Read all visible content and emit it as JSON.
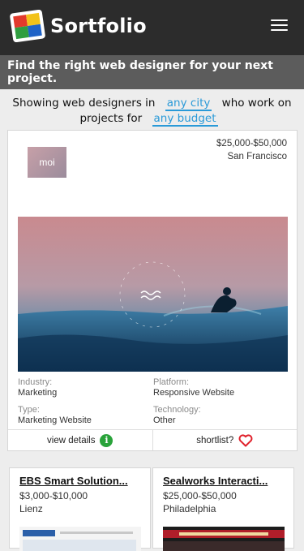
{
  "header": {
    "brand": "Sortfolio",
    "logo_icon": "sortfolio-logo-icon",
    "menu_icon": "hamburger-menu-icon"
  },
  "tagline": "Find the right web designer for your next project.",
  "filter": {
    "prefix": "Showing web designers in",
    "city_link": "any city",
    "middle": "who work on projects for",
    "budget_link": "any budget"
  },
  "featured": {
    "budget": "$25,000-$50,000",
    "city": "San Francisco",
    "logo_text": "moi",
    "industry_label": "Industry:",
    "industry": "Marketing",
    "platform_label": "Platform:",
    "platform": "Responsive Website",
    "type_label": "Type:",
    "type": "Marketing Website",
    "technology_label": "Technology:",
    "technology": "Other",
    "view_details": "view details",
    "shortlist": "shortlist?",
    "info_icon": "info-icon",
    "heart_icon": "heart-icon"
  },
  "listings": [
    {
      "name": "EBS Smart Solution...",
      "budget": "$3,000-$10,000",
      "city": "Lienz"
    },
    {
      "name": "Sealworks Interacti...",
      "budget": "$25,000-$50,000",
      "city": "Philadelphia"
    }
  ],
  "colors": {
    "header_bg": "#2c2c2c",
    "tagline_bg": "#5c5c5c",
    "link": "#2a9ad8",
    "info": "#29a33a",
    "heart": "#e0202a"
  }
}
